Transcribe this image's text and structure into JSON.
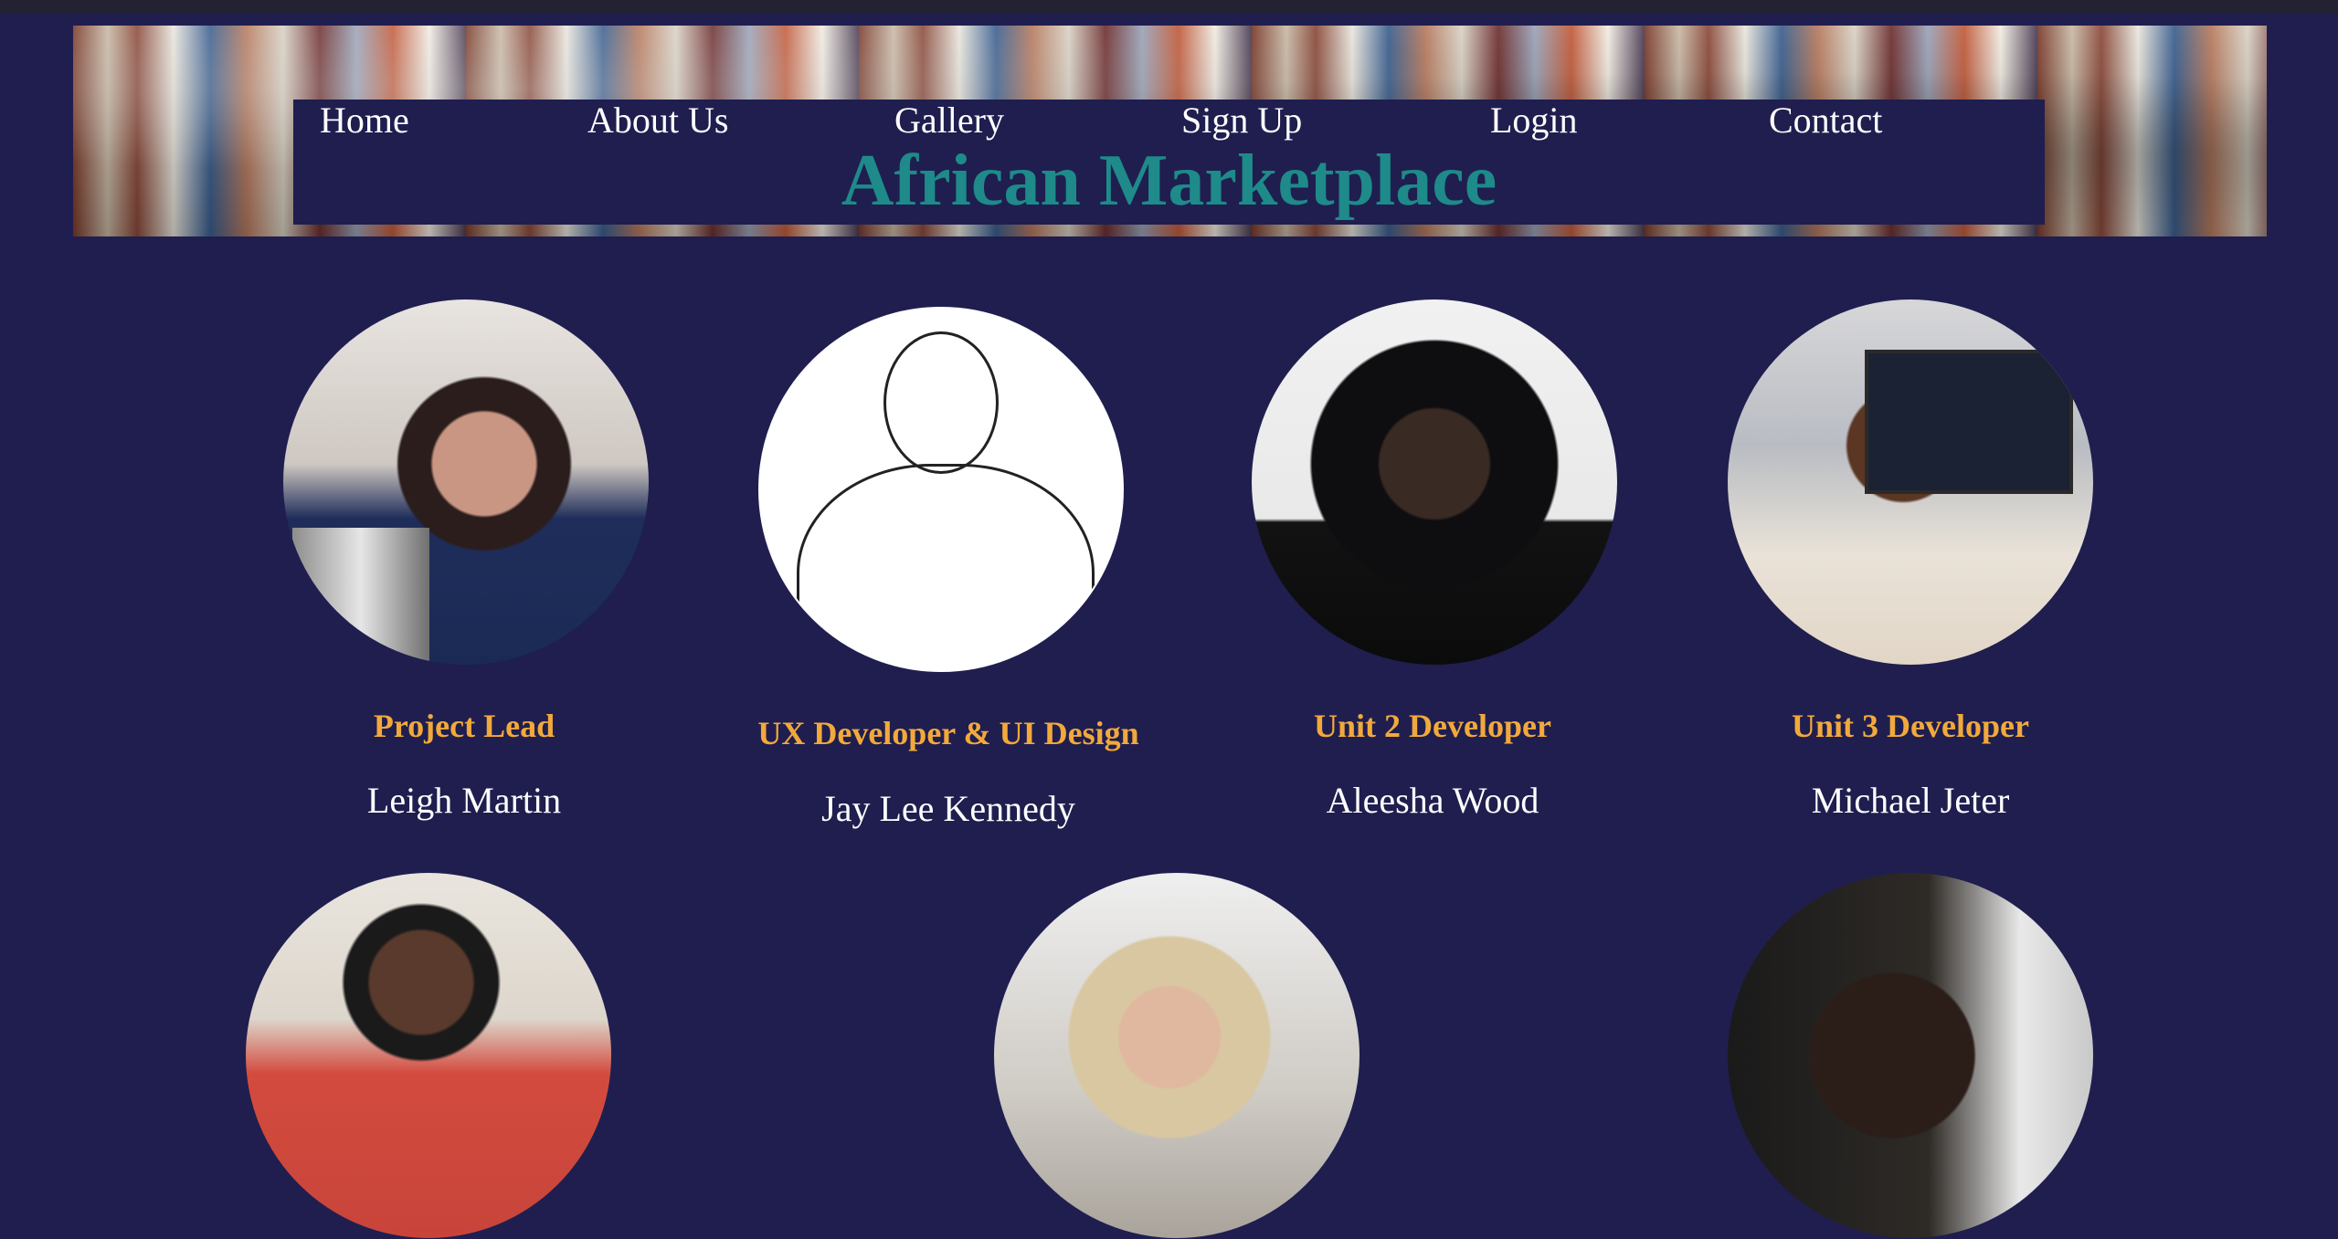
{
  "site": {
    "title": "African Marketplace"
  },
  "nav": {
    "items": [
      {
        "label": "Home"
      },
      {
        "label": "About Us"
      },
      {
        "label": "Gallery"
      },
      {
        "label": "Sign Up"
      },
      {
        "label": "Login"
      },
      {
        "label": "Contact"
      }
    ]
  },
  "team": {
    "members": [
      {
        "role": "Project Lead",
        "name": "Leigh Martin"
      },
      {
        "role": "UX Developer & UI Design",
        "name": "Jay Lee Kennedy"
      },
      {
        "role": "Unit 2 Developer",
        "name": "Aleesha Wood"
      },
      {
        "role": "Unit 3 Developer",
        "name": "Michael Jeter"
      }
    ]
  },
  "colors": {
    "background": "#1f1e4f",
    "title": "#1e8a8a",
    "role": "#f2a93b",
    "text": "#ffffff"
  },
  "icons": {
    "avatar": "profile-photo"
  }
}
